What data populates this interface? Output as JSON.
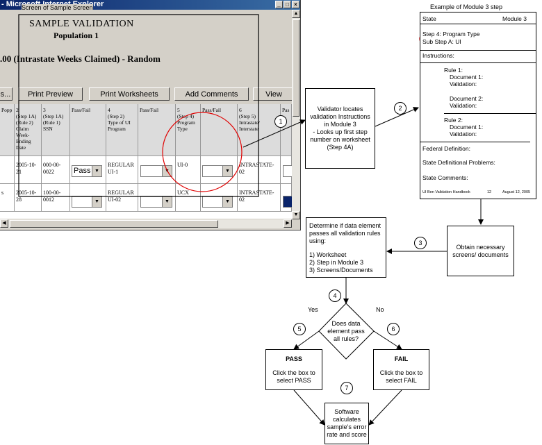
{
  "browser": {
    "title": "- Microsoft Internet Explorer",
    "screen_label": "Screen of Sample Screen",
    "heading": "SAMPLE VALIDATION",
    "population": "Population 1",
    "subheading": ".00 (Intrastate Weeks Claimed) - Random",
    "buttons": [
      "s...",
      "Print Preview",
      "Print Worksheets",
      "Add Comments",
      "View"
    ],
    "columns": [
      "Popp",
      "2\n(Step 1A)\n(Rule 2)\nClaim\nWeek-\nEnding\nDate",
      "3\n(Step 1A)\n(Rule 1)\nSSN",
      "Pass/Fail",
      "4\n(Step 2)\nType of UI\nProgram",
      "Pass/Fail",
      "5\n(Step 4)\nProgram\nType",
      "Pass/Fail",
      "6\n(Step 5)\nIntrastate/\nInterstate",
      "Pas"
    ],
    "rows": [
      [
        "",
        "2005-10-\n21",
        "000-00-\n0022",
        "Pass",
        "REGULAR\nUI-1",
        "",
        "UI-0",
        "",
        "INTRASTATE-\n02",
        ""
      ],
      [
        "s",
        "2005-10-\n28",
        "100-00-\n0012",
        "",
        "REGULAR\nUI-02",
        "",
        "UCX",
        "",
        "INTRASTATE-\n02",
        ""
      ]
    ]
  },
  "module_doc": {
    "caption": "Example of Module 3 step",
    "state": "State",
    "module": "Module 3",
    "step": "Step 4: Program Type",
    "substep": "Sub Step A: UI",
    "instructions": "Instructions:",
    "rule1": "Rule 1:",
    "doc1": "Document 1:",
    "validation1": "Validation:",
    "doc2": "Document 2:",
    "validation2": "Validation:",
    "rule2": "Rule 2:",
    "doc1b": "Document 1:",
    "validation1b": "Validation:",
    "federal": "Federal Definition:",
    "problems": "State Definitional Problems:",
    "comments": "State Comments:",
    "footer_left": "UI Ben Validation Handbook",
    "footer_mid": "12",
    "footer_right": "August 12, 2005"
  },
  "flow": {
    "step1": "Validator locates validation Instructions in Module 3\n- Looks up first step number on worksheet (Step 4A)",
    "step3": "Obtain necessary screens/ documents",
    "step_determine": "Determine if data element passes all validation rules using:",
    "step_list": "1) Worksheet\n2) Step in Module 3\n3) Screens/Documents",
    "decision": "Does data element pass all rules?",
    "yes": "Yes",
    "no": "No",
    "pass_title": "PASS",
    "pass_text": "Click the box to select PASS",
    "fail_title": "FAIL",
    "fail_text": "Click the box to select FAIL",
    "software": "Software calculates sample's error rate and score",
    "numbers": [
      "1",
      "2",
      "3",
      "4",
      "5",
      "6",
      "7"
    ]
  },
  "colors": {
    "highlight": "#e00000",
    "titlebar": "#0a246a"
  }
}
